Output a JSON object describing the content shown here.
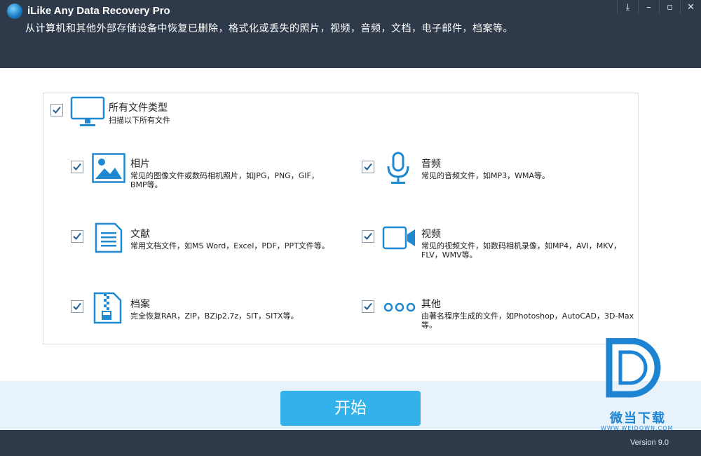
{
  "window": {
    "title": "iLike Any Data Recovery Pro",
    "subtitle": "从计算机和其他外部存储设备中恢复已删除，格式化或丢失的照片，视频，音频，文档，电子邮件，档案等。"
  },
  "window_buttons": {
    "download": "⤓",
    "minimize": "–",
    "maximize": "▫",
    "close": "✕"
  },
  "all_types": {
    "title": "所有文件类型",
    "desc": "扫描以下所有文件",
    "checked": true
  },
  "file_types": {
    "photo": {
      "title": "相片",
      "desc": "常见的图像文件或数码相机照片，如JPG，PNG，GIF，BMP等。",
      "checked": true,
      "icon": "image-icon"
    },
    "audio": {
      "title": "音频",
      "desc": "常见的音频文件，如MP3，WMA等。",
      "checked": true,
      "icon": "microphone-icon"
    },
    "document": {
      "title": "文献",
      "desc": "常用文档文件，如MS Word，Excel，PDF，PPT文件等。",
      "checked": true,
      "icon": "document-icon"
    },
    "video": {
      "title": "视频",
      "desc": "常见的视频文件，如数码相机录像，如MP4，AVI，MKV，FLV，WMV等。",
      "checked": true,
      "icon": "video-camera-icon"
    },
    "archive": {
      "title": "档案",
      "desc": "完全恢复RAR，ZIP，BZip2,7z，SIT，SITX等。",
      "checked": true,
      "icon": "archive-file-icon"
    },
    "other": {
      "title": "其他",
      "desc": "由著名程序生成的文件，如Photoshop，AutoCAD，3D-Max等。",
      "checked": true,
      "icon": "more-icon"
    }
  },
  "start_button": {
    "label": "开始"
  },
  "status": {
    "version": "Version 9.0"
  },
  "watermark": {
    "text": "微当下载",
    "url": "WWW.WEIDOWN.COM"
  },
  "colors": {
    "titlebar": "#2e3a4a",
    "accent": "#33b1ea",
    "icon_blue": "#1e88d0",
    "bottom_area": "#e8f2fa"
  }
}
